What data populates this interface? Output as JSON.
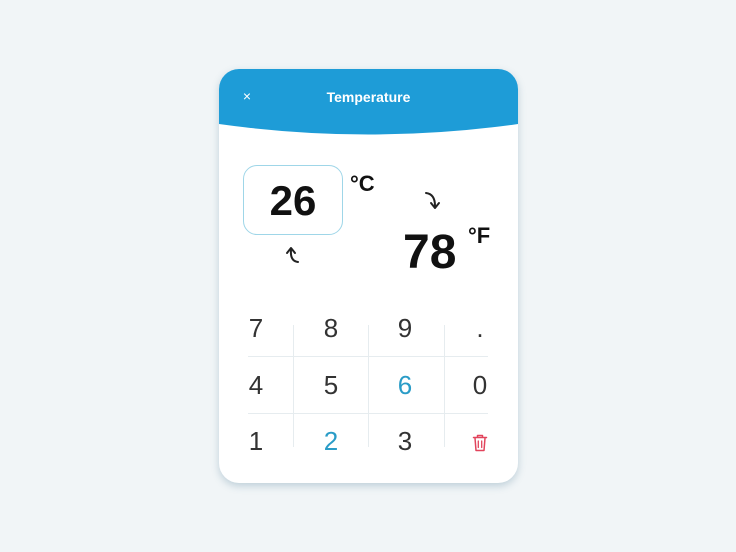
{
  "header": {
    "title": "Temperature",
    "close_label": "×",
    "bg_color": "#1e9cd7"
  },
  "converter": {
    "input_value": "26",
    "input_unit": "°C",
    "output_value": "78",
    "output_unit": "°F"
  },
  "keypad": {
    "keys": [
      "7",
      "8",
      "9",
      ".",
      "4",
      "5",
      "6",
      "0",
      "1",
      "2",
      "3"
    ],
    "accent_keys": [
      "6",
      "2"
    ],
    "accent_color": "#2a9cc7",
    "delete_icon": "trash-icon",
    "delete_color": "#e2445c"
  }
}
